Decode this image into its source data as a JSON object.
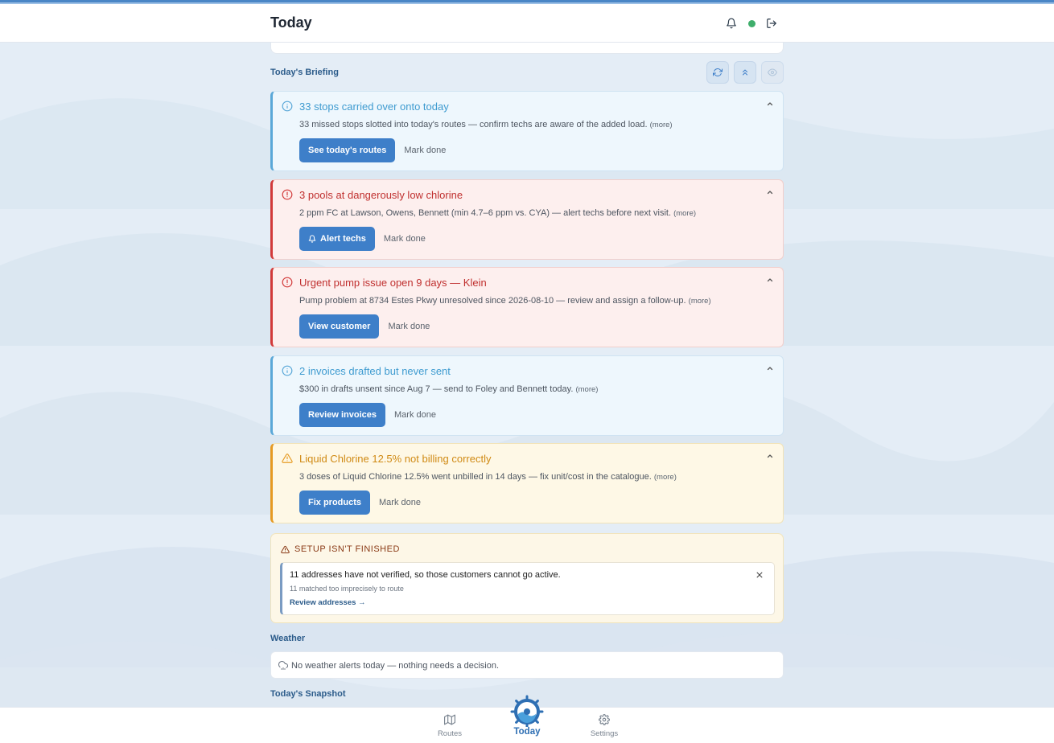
{
  "header": {
    "title": "Today",
    "notifications_icon": "bell-icon",
    "status": "online",
    "logout_icon": "logout-icon"
  },
  "briefing": {
    "title": "Today's Briefing",
    "tools": [
      "refresh-icon",
      "collapse-all-icon",
      "eye-icon"
    ],
    "alerts": [
      {
        "severity": "info",
        "icon": "info-icon",
        "title": "33 stops carried over onto today",
        "body": "33 missed stops slotted into today's routes — confirm techs are aware of the added load.",
        "more": "(more)",
        "action": "See today's routes",
        "action_icon": "",
        "dismiss": "Mark done"
      },
      {
        "severity": "danger",
        "icon": "alert-circle-icon",
        "title": "3 pools at dangerously low chlorine",
        "body": "2 ppm FC at Lawson, Owens, Bennett (min 4.7–6 ppm vs. CYA) — alert techs before next visit.",
        "more": "(more)",
        "action": "Alert techs",
        "action_icon": "bell-icon",
        "dismiss": "Mark done"
      },
      {
        "severity": "danger",
        "icon": "alert-circle-icon",
        "title": "Urgent pump issue open 9 days — Klein",
        "body": "Pump problem at 8734 Estes Pkwy unresolved since 2026-08-10 — review and assign a follow-up.",
        "more": "(more)",
        "action": "View customer",
        "action_icon": "",
        "dismiss": "Mark done"
      },
      {
        "severity": "info",
        "icon": "info-icon",
        "title": "2 invoices drafted but never sent",
        "body": "$300 in drafts unsent since Aug 7 — send to Foley and Bennett today.",
        "more": "(more)",
        "action": "Review invoices",
        "action_icon": "",
        "dismiss": "Mark done"
      },
      {
        "severity": "warning",
        "icon": "warning-triangle-icon",
        "title": "Liquid Chlorine 12.5% not billing correctly",
        "body": "3 doses of Liquid Chlorine 12.5% went unbilled in 14 days — fix unit/cost in the catalogue.",
        "more": "(more)",
        "action": "Fix products",
        "action_icon": "",
        "dismiss": "Mark done"
      }
    ]
  },
  "setup": {
    "title": "SETUP ISN'T FINISHED",
    "message": "11 addresses have not verified, so those customers cannot go active.",
    "sub": "11 matched too imprecisely to route",
    "link": "Review addresses →"
  },
  "weather": {
    "title": "Weather",
    "text": "No weather alerts today — nothing needs a decision."
  },
  "snapshot": {
    "title": "Today's Snapshot"
  },
  "nav": {
    "routes": "Routes",
    "today": "Today",
    "settings": "Settings"
  },
  "colors": {
    "primary": "#3e7fc9",
    "info": "#5aa8d8",
    "danger": "#d23a3a",
    "warning": "#e69a22",
    "status_online": "#3fae6b"
  }
}
